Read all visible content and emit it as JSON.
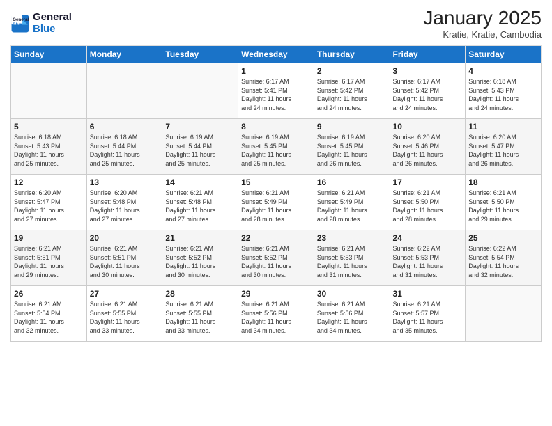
{
  "header": {
    "logo_line1": "General",
    "logo_line2": "Blue",
    "month": "January 2025",
    "location": "Kratie, Kratie, Cambodia"
  },
  "weekdays": [
    "Sunday",
    "Monday",
    "Tuesday",
    "Wednesday",
    "Thursday",
    "Friday",
    "Saturday"
  ],
  "weeks": [
    [
      {
        "day": "",
        "info": ""
      },
      {
        "day": "",
        "info": ""
      },
      {
        "day": "",
        "info": ""
      },
      {
        "day": "1",
        "info": "Sunrise: 6:17 AM\nSunset: 5:41 PM\nDaylight: 11 hours\nand 24 minutes."
      },
      {
        "day": "2",
        "info": "Sunrise: 6:17 AM\nSunset: 5:42 PM\nDaylight: 11 hours\nand 24 minutes."
      },
      {
        "day": "3",
        "info": "Sunrise: 6:17 AM\nSunset: 5:42 PM\nDaylight: 11 hours\nand 24 minutes."
      },
      {
        "day": "4",
        "info": "Sunrise: 6:18 AM\nSunset: 5:43 PM\nDaylight: 11 hours\nand 24 minutes."
      }
    ],
    [
      {
        "day": "5",
        "info": "Sunrise: 6:18 AM\nSunset: 5:43 PM\nDaylight: 11 hours\nand 25 minutes."
      },
      {
        "day": "6",
        "info": "Sunrise: 6:18 AM\nSunset: 5:44 PM\nDaylight: 11 hours\nand 25 minutes."
      },
      {
        "day": "7",
        "info": "Sunrise: 6:19 AM\nSunset: 5:44 PM\nDaylight: 11 hours\nand 25 minutes."
      },
      {
        "day": "8",
        "info": "Sunrise: 6:19 AM\nSunset: 5:45 PM\nDaylight: 11 hours\nand 25 minutes."
      },
      {
        "day": "9",
        "info": "Sunrise: 6:19 AM\nSunset: 5:45 PM\nDaylight: 11 hours\nand 26 minutes."
      },
      {
        "day": "10",
        "info": "Sunrise: 6:20 AM\nSunset: 5:46 PM\nDaylight: 11 hours\nand 26 minutes."
      },
      {
        "day": "11",
        "info": "Sunrise: 6:20 AM\nSunset: 5:47 PM\nDaylight: 11 hours\nand 26 minutes."
      }
    ],
    [
      {
        "day": "12",
        "info": "Sunrise: 6:20 AM\nSunset: 5:47 PM\nDaylight: 11 hours\nand 27 minutes."
      },
      {
        "day": "13",
        "info": "Sunrise: 6:20 AM\nSunset: 5:48 PM\nDaylight: 11 hours\nand 27 minutes."
      },
      {
        "day": "14",
        "info": "Sunrise: 6:21 AM\nSunset: 5:48 PM\nDaylight: 11 hours\nand 27 minutes."
      },
      {
        "day": "15",
        "info": "Sunrise: 6:21 AM\nSunset: 5:49 PM\nDaylight: 11 hours\nand 28 minutes."
      },
      {
        "day": "16",
        "info": "Sunrise: 6:21 AM\nSunset: 5:49 PM\nDaylight: 11 hours\nand 28 minutes."
      },
      {
        "day": "17",
        "info": "Sunrise: 6:21 AM\nSunset: 5:50 PM\nDaylight: 11 hours\nand 28 minutes."
      },
      {
        "day": "18",
        "info": "Sunrise: 6:21 AM\nSunset: 5:50 PM\nDaylight: 11 hours\nand 29 minutes."
      }
    ],
    [
      {
        "day": "19",
        "info": "Sunrise: 6:21 AM\nSunset: 5:51 PM\nDaylight: 11 hours\nand 29 minutes."
      },
      {
        "day": "20",
        "info": "Sunrise: 6:21 AM\nSunset: 5:51 PM\nDaylight: 11 hours\nand 30 minutes."
      },
      {
        "day": "21",
        "info": "Sunrise: 6:21 AM\nSunset: 5:52 PM\nDaylight: 11 hours\nand 30 minutes."
      },
      {
        "day": "22",
        "info": "Sunrise: 6:21 AM\nSunset: 5:52 PM\nDaylight: 11 hours\nand 30 minutes."
      },
      {
        "day": "23",
        "info": "Sunrise: 6:21 AM\nSunset: 5:53 PM\nDaylight: 11 hours\nand 31 minutes."
      },
      {
        "day": "24",
        "info": "Sunrise: 6:22 AM\nSunset: 5:53 PM\nDaylight: 11 hours\nand 31 minutes."
      },
      {
        "day": "25",
        "info": "Sunrise: 6:22 AM\nSunset: 5:54 PM\nDaylight: 11 hours\nand 32 minutes."
      }
    ],
    [
      {
        "day": "26",
        "info": "Sunrise: 6:21 AM\nSunset: 5:54 PM\nDaylight: 11 hours\nand 32 minutes."
      },
      {
        "day": "27",
        "info": "Sunrise: 6:21 AM\nSunset: 5:55 PM\nDaylight: 11 hours\nand 33 minutes."
      },
      {
        "day": "28",
        "info": "Sunrise: 6:21 AM\nSunset: 5:55 PM\nDaylight: 11 hours\nand 33 minutes."
      },
      {
        "day": "29",
        "info": "Sunrise: 6:21 AM\nSunset: 5:56 PM\nDaylight: 11 hours\nand 34 minutes."
      },
      {
        "day": "30",
        "info": "Sunrise: 6:21 AM\nSunset: 5:56 PM\nDaylight: 11 hours\nand 34 minutes."
      },
      {
        "day": "31",
        "info": "Sunrise: 6:21 AM\nSunset: 5:57 PM\nDaylight: 11 hours\nand 35 minutes."
      },
      {
        "day": "",
        "info": ""
      }
    ]
  ]
}
